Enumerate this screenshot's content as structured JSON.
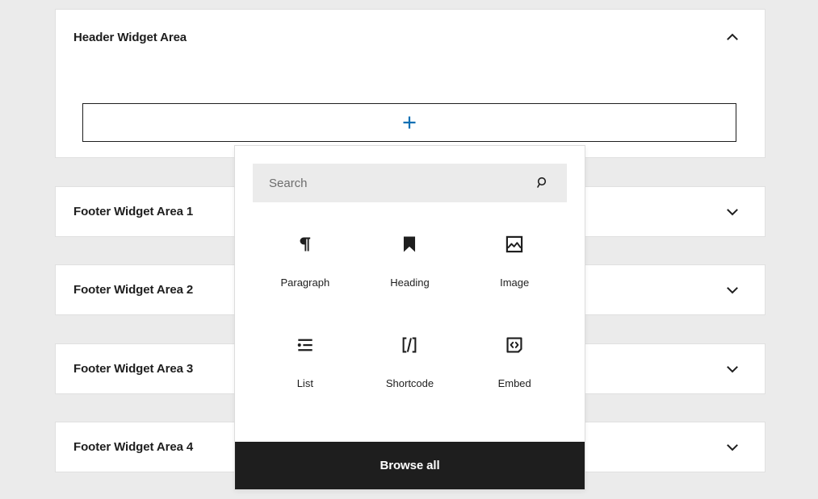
{
  "theme": {
    "page_background": "#ebebeb",
    "panel_background": "#ffffff",
    "accent_blue": "#0a6fb4",
    "dark": "#1e1e1e",
    "search_background": "#ebebeb",
    "text_color": "#1e1e1e",
    "placeholder_color": "#6d6d6d"
  },
  "widget_areas": [
    {
      "title": "Header Widget Area",
      "expanded": true,
      "toggle_icon": "chevron-up-icon"
    },
    {
      "title": "Footer Widget Area 1",
      "expanded": false,
      "toggle_icon": "chevron-down-icon"
    },
    {
      "title": "Footer Widget Area 2",
      "expanded": false,
      "toggle_icon": "chevron-down-icon"
    },
    {
      "title": "Footer Widget Area 3",
      "expanded": false,
      "toggle_icon": "chevron-down-icon"
    },
    {
      "title": "Footer Widget Area 4",
      "expanded": false,
      "toggle_icon": "chevron-down-icon"
    }
  ],
  "appender": {
    "icon": "plus-icon",
    "label": ""
  },
  "inserter": {
    "search": {
      "value": "",
      "placeholder": "Search",
      "icon": "search-icon"
    },
    "blocks": [
      {
        "label": "Paragraph",
        "icon": "paragraph-icon"
      },
      {
        "label": "Heading",
        "icon": "heading-icon"
      },
      {
        "label": "Image",
        "icon": "image-icon"
      },
      {
        "label": "List",
        "icon": "list-icon"
      },
      {
        "label": "Shortcode",
        "icon": "shortcode-icon"
      },
      {
        "label": "Embed",
        "icon": "embed-icon"
      }
    ],
    "browse_all_label": "Browse all"
  }
}
